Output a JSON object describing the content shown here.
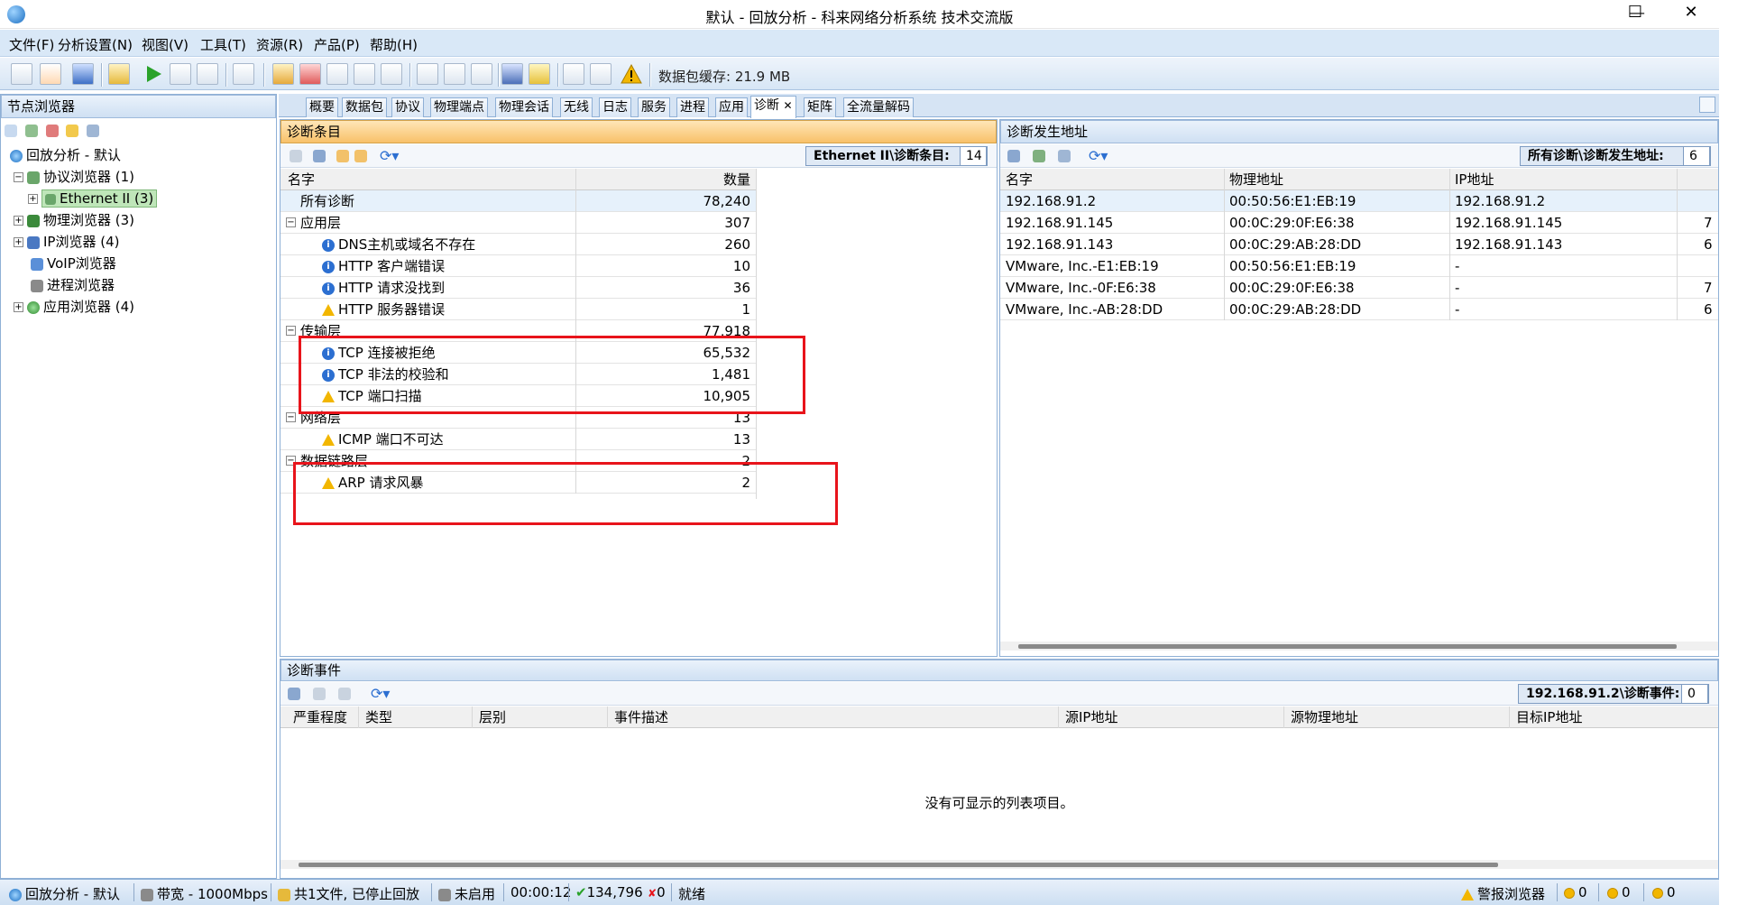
{
  "window": {
    "title": "默认 - 回放分析 - 科来网络分析系统 技术交流版",
    "controls": [
      "—",
      "☐",
      "✕"
    ]
  },
  "menu": [
    "文件(F)",
    "分析设置(N)",
    "视图(V)",
    "工具(T)",
    "资源(R)",
    "产品(P)",
    "帮助(H)"
  ],
  "toolbar": {
    "cache_label": "数据包缓存: 21.9 MB"
  },
  "left_pane": {
    "title": "节点浏览器",
    "root": "回放分析 - 默认",
    "items": [
      {
        "label": "协议浏览器 (1)",
        "expander": "−"
      },
      {
        "label": "Ethernet II (3)",
        "expander": "+"
      },
      {
        "label": "物理浏览器 (3)",
        "expander": "+"
      },
      {
        "label": "IP浏览器 (4)",
        "expander": "+"
      },
      {
        "label": "VoIP浏览器",
        "expander": ""
      },
      {
        "label": "进程浏览器",
        "expander": ""
      },
      {
        "label": "应用浏览器 (4)",
        "expander": "+"
      }
    ]
  },
  "tabs": [
    "概要",
    "数据包",
    "协议",
    "物理端点",
    "物理会话",
    "无线",
    "日志",
    "服务",
    "进程",
    "应用",
    "诊断",
    "矩阵",
    "全流量解码"
  ],
  "active_tab_close": "✕",
  "diag_items": {
    "title": "诊断条目",
    "badge_label": "Ethernet II\\诊断条目:",
    "badge_value": "14",
    "col_name": "名字",
    "col_count": "数量",
    "rows": [
      {
        "name": "所有诊断",
        "count": "78,240",
        "level": 0,
        "icon": "",
        "expander": ""
      },
      {
        "name": "应用层",
        "count": "307",
        "level": 0,
        "icon": "",
        "expander": "−"
      },
      {
        "name": "DNS主机或域名不存在",
        "count": "260",
        "level": 1,
        "icon": "info",
        "expander": ""
      },
      {
        "name": "HTTP 客户端错误",
        "count": "10",
        "level": 1,
        "icon": "info",
        "expander": ""
      },
      {
        "name": "HTTP 请求没找到",
        "count": "36",
        "level": 1,
        "icon": "info",
        "expander": ""
      },
      {
        "name": "HTTP 服务器错误",
        "count": "1",
        "level": 1,
        "icon": "warn",
        "expander": ""
      },
      {
        "name": "传输层",
        "count": "77,918",
        "level": 0,
        "icon": "",
        "expander": "−"
      },
      {
        "name": "TCP 连接被拒绝",
        "count": "65,532",
        "level": 1,
        "icon": "info",
        "expander": ""
      },
      {
        "name": "TCP 非法的校验和",
        "count": "1,481",
        "level": 1,
        "icon": "info",
        "expander": ""
      },
      {
        "name": "TCP 端口扫描",
        "count": "10,905",
        "level": 1,
        "icon": "warn",
        "expander": ""
      },
      {
        "name": "网络层",
        "count": "13",
        "level": 0,
        "icon": "",
        "expander": "−"
      },
      {
        "name": "ICMP 端口不可达",
        "count": "13",
        "level": 1,
        "icon": "warn",
        "expander": ""
      },
      {
        "name": "数据链路层",
        "count": "2",
        "level": 0,
        "icon": "",
        "expander": "−"
      },
      {
        "name": "ARP 请求风暴",
        "count": "2",
        "level": 1,
        "icon": "warn",
        "expander": ""
      }
    ]
  },
  "diag_addr": {
    "title": "诊断发生地址",
    "badge_label": "所有诊断\\诊断发生地址:",
    "badge_value": "6",
    "cols": [
      "名字",
      "物理地址",
      "IP地址"
    ],
    "rows": [
      {
        "name": "192.168.91.2",
        "mac": "00:50:56:E1:EB:19",
        "ip": "192.168.91.2",
        "extra": ""
      },
      {
        "name": "192.168.91.145",
        "mac": "00:0C:29:0F:E6:38",
        "ip": "192.168.91.145",
        "extra": "7"
      },
      {
        "name": "192.168.91.143",
        "mac": "00:0C:29:AB:28:DD",
        "ip": "192.168.91.143",
        "extra": "6"
      },
      {
        "name": "VMware, Inc.-E1:EB:19",
        "mac": "00:50:56:E1:EB:19",
        "ip": "-",
        "extra": ""
      },
      {
        "name": "VMware, Inc.-0F:E6:38",
        "mac": "00:0C:29:0F:E6:38",
        "ip": "-",
        "extra": "7"
      },
      {
        "name": "VMware, Inc.-AB:28:DD",
        "mac": "00:0C:29:AB:28:DD",
        "ip": "-",
        "extra": "6"
      }
    ]
  },
  "diag_events": {
    "title": "诊断事件",
    "badge_label": "192.168.91.2\\诊断事件:",
    "badge_value": "0",
    "cols": [
      "严重程度",
      "类型",
      "层别",
      "事件描述",
      "源IP地址",
      "源物理地址",
      "目标IP地址"
    ],
    "empty_text": "没有可显示的列表项目。"
  },
  "status": {
    "mode": "回放分析 - 默认",
    "bandwidth": "带宽 - 1000Mbps",
    "files": "共1文件, 已停止回放",
    "filter": "未启用",
    "time": "00:00:12",
    "packets": "134,796",
    "dropped": "0",
    "state": "就绪",
    "alarm": "警报浏览器",
    "alarm_counts": [
      "0",
      "0",
      "0"
    ]
  },
  "colors": {
    "accent": "#d9e8f7",
    "orange_header": "#f8c169",
    "highlight": "#e8141b",
    "selected_tree": "#bfe6b9"
  }
}
